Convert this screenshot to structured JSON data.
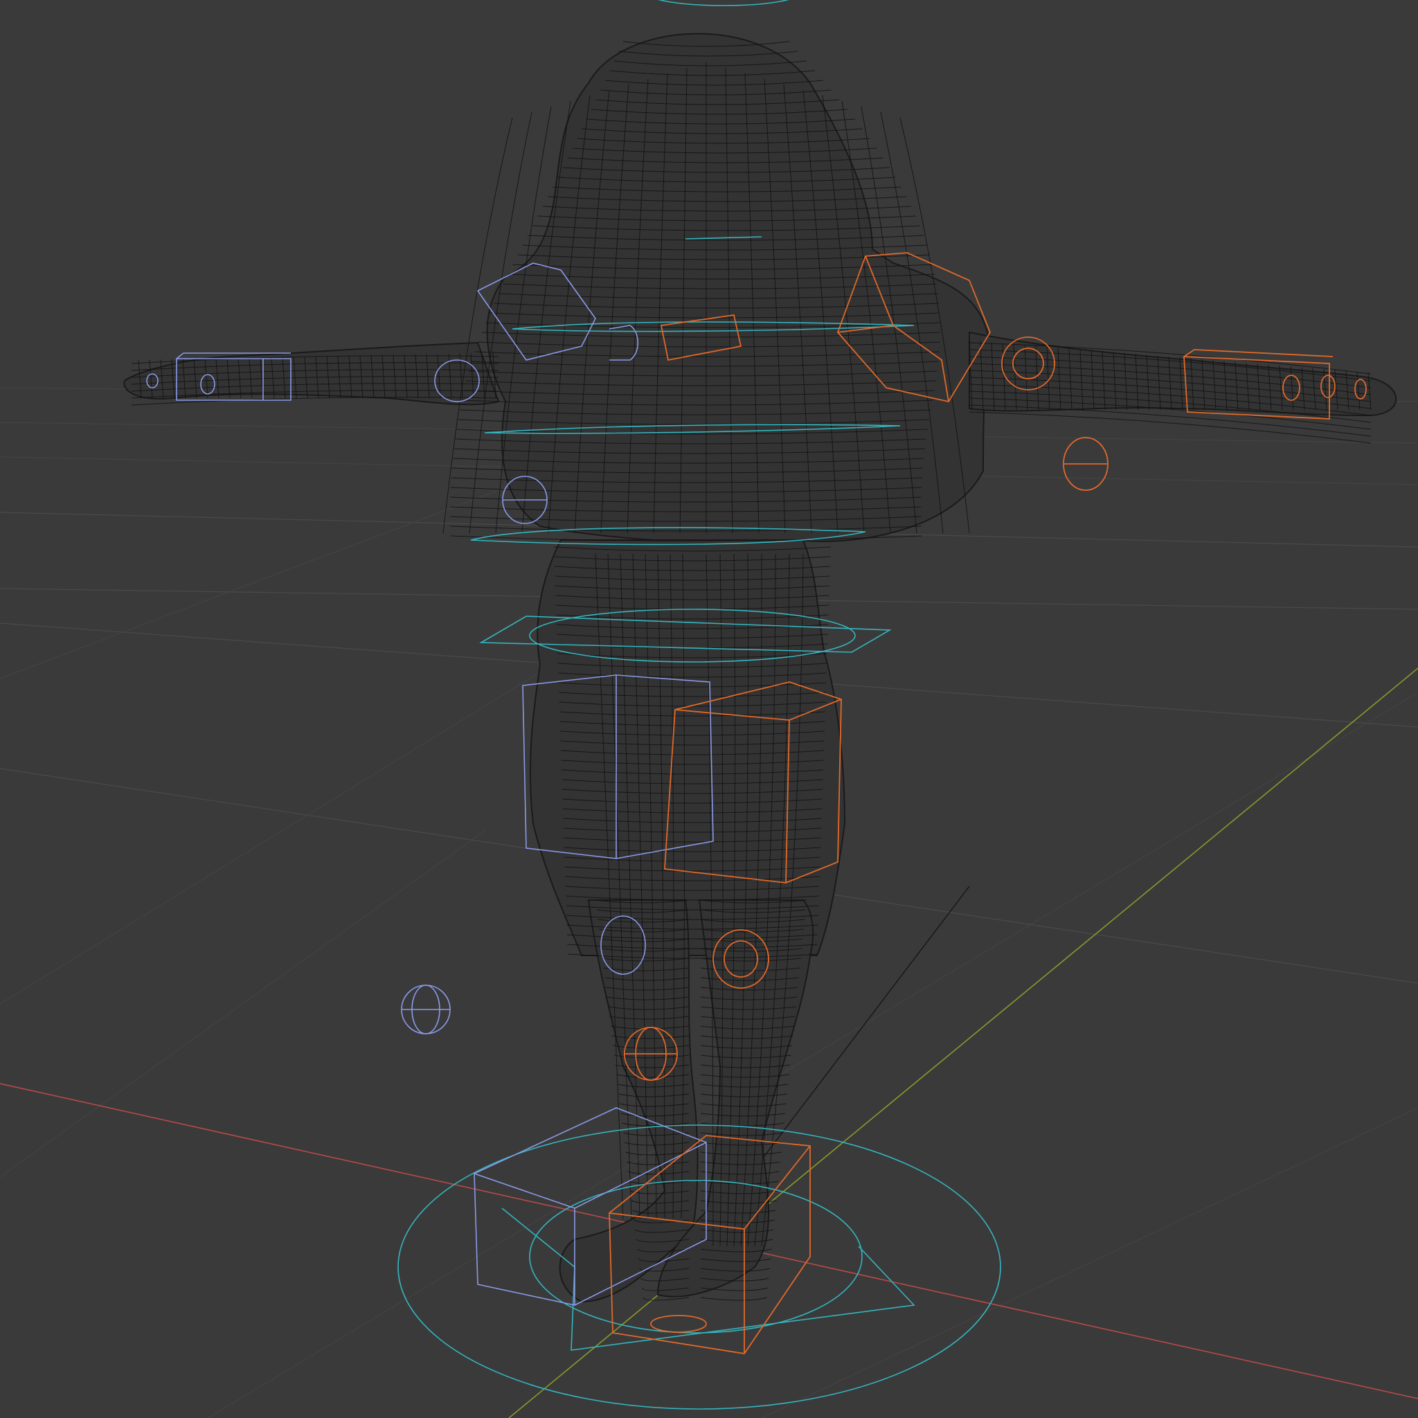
{
  "viewport": {
    "mode": "wireframe",
    "background_color": "#3a3a3a",
    "grid_color": "#4a4a4a",
    "axis_colors": {
      "x": "#b84a4a",
      "y": "#8a9a2a"
    },
    "object_type": "rigged character mesh",
    "pose": "T-pose",
    "wire_color": "#121212"
  },
  "controls": {
    "colors": {
      "left_side": "#8a9ae8",
      "right_side": "#e0692a",
      "center": "#35b5bf"
    }
  }
}
